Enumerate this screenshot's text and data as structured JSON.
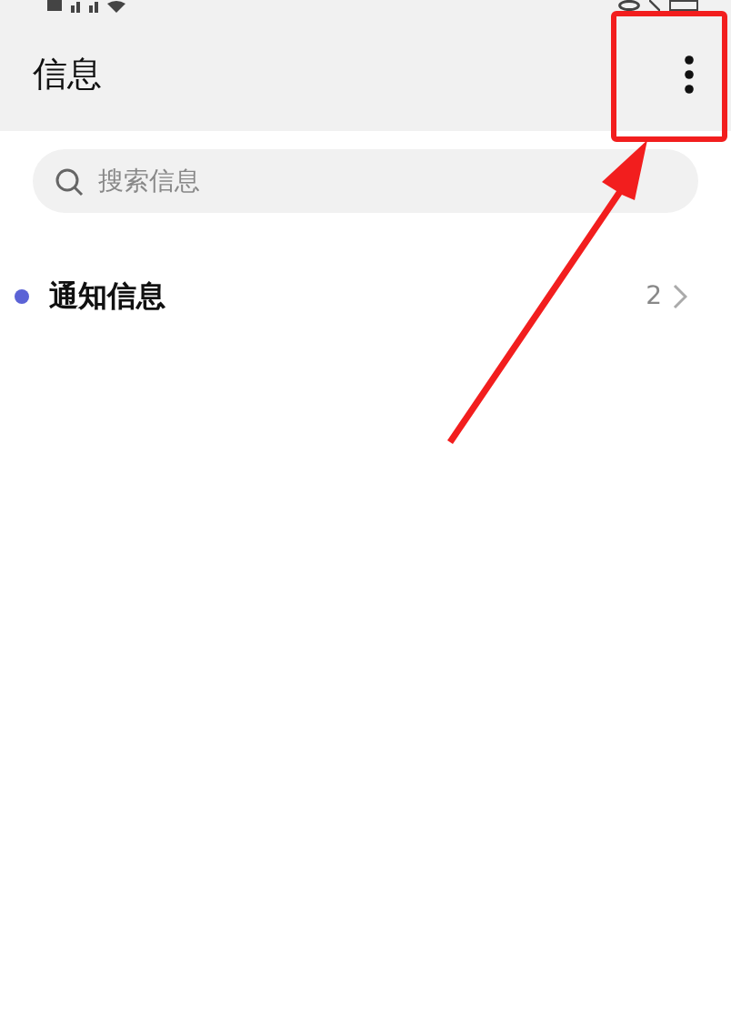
{
  "header": {
    "title": "信息"
  },
  "search": {
    "placeholder": "搜索信息"
  },
  "conversations": [
    {
      "name": "通知信息",
      "unread": true,
      "count": "2"
    }
  ],
  "annotation": {
    "kind": "box-arrow"
  }
}
